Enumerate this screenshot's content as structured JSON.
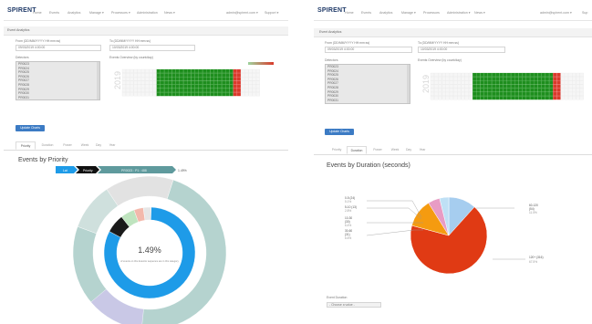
{
  "app": {
    "logo": "SPIRENT",
    "logo_sub": ""
  },
  "left": {
    "nav": [
      "Home",
      "Events",
      "Analytics",
      "Manage ▾",
      "Processors ▾",
      "Administration",
      "News ▾"
    ],
    "user_email": "admin@spirent.com ▾",
    "support": "Support ▾",
    "page_title": "Event Analytics",
    "from_label": "From (DD/MM/YYYY HH:mm:ss)",
    "from_value": "09/03/2019 4:00:00",
    "to_label": "To (DD/MM/YYYY HH:mm:ss)",
    "to_value": "10/03/2019 4:00:00",
    "detectors_label": "Detectors",
    "detectors": [
      "PR0023",
      "PR0024",
      "PR0025",
      "PR0026",
      "PR0027",
      "PR0028",
      "PR0029",
      "PR0030",
      "PR0031"
    ],
    "overview_label": "Events Overview (by count/day)",
    "year": "2019",
    "update_button": "Update Charts",
    "tabs": [
      "Priority",
      "Duration",
      "Power",
      "Week",
      "Day",
      "Year"
    ],
    "active_tab": "Priority",
    "chart_title": "Events by Priority",
    "breadcrumb": [
      "Lat",
      "Priority",
      "PR0023 : P1 : 488"
    ],
    "breadcrumb_pct": "1.49%",
    "center_value": "1.49%",
    "center_caption": "of events on this detector sequence are in this category"
  },
  "right": {
    "nav": [
      "Home",
      "Events",
      "Analytics",
      "Manage ▾",
      "Processors",
      "Administration ▾",
      "News ▾"
    ],
    "user_email": "admin@spirent.com ▾",
    "support": "Sup",
    "page_title": "Event Analytics",
    "from_label": "From (DD/MM/YYYY HH:mm:ss)",
    "from_value": "09/03/2019 4:00:00",
    "to_label": "To (DD/MM/YYYY HH:mm:ss)",
    "to_value": "10/03/2019 4:00:00",
    "detectors_label": "Detectors",
    "detectors": [
      "PR0023",
      "PR0024",
      "PR0025",
      "PR0026",
      "PR0027",
      "PR0028",
      "PR0029",
      "PR0030",
      "PR0031"
    ],
    "overview_label": "Events Overview (by count/day)",
    "year": "2019",
    "update_button": "Update Charts",
    "tabs": [
      "Priority",
      "Duration",
      "Power",
      "Week",
      "Day",
      "Year"
    ],
    "active_tab": "Duration",
    "chart_title": "Events by Duration (seconds)",
    "pie_labels_left": [
      "0-5 (24)",
      "5.1%",
      "5-10 (13)",
      "2.8%",
      "10-30",
      "(30)",
      "6.4%",
      "30-60",
      "(31)",
      "6.6%"
    ],
    "pie_label_right_top": [
      "60-120",
      "(54)",
      "11.5%"
    ],
    "pie_label_right_bottom": [
      "120+ (316)",
      "67.5%"
    ],
    "duration_select_label": "Event Duration",
    "duration_select_value": "- Choose a value -"
  },
  "colors": {
    "accent": "#3c7bc4",
    "heat_green": "#1e8e1e",
    "heat_red": "#d93a2b",
    "sun_blue": "#1e9be8",
    "sun_grey": "#9a9a9a",
    "sun_teal": "#b5d3cf",
    "pie_red": "#e03a14",
    "pie_orange": "#f59b10",
    "pie_blue": "#a6cdef",
    "pie_pink": "#e89cc4"
  }
}
